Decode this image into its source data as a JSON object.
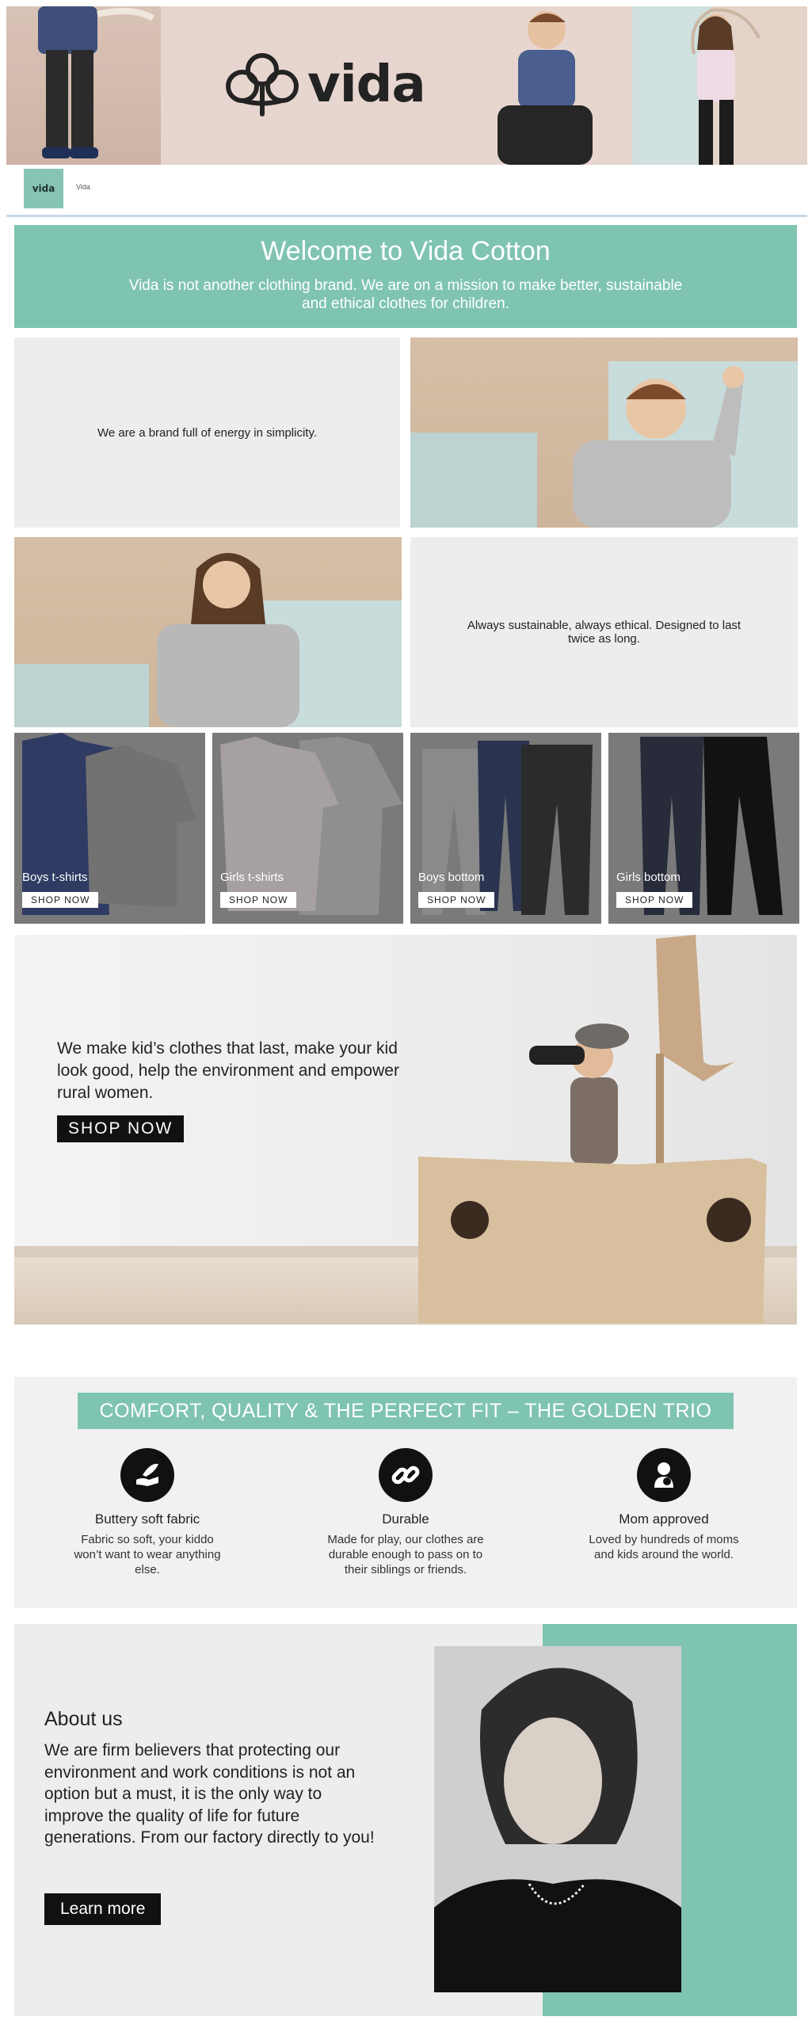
{
  "brand": {
    "logo_word": "vida",
    "nav_name": "Vida"
  },
  "welcome": {
    "title": "Welcome to Vida Cotton",
    "subtitle": "Vida is not another clothing brand. We are on a mission to make better, sustainable and ethical clothes for children."
  },
  "intro": {
    "text1": "We are a brand full of energy in simplicity.",
    "text2": "Always sustainable, always ethical. Designed to last twice as long."
  },
  "products": [
    {
      "label": "Boys t-shirts",
      "button": "SHOP NOW"
    },
    {
      "label": "Girls t-shirts",
      "button": "SHOP NOW"
    },
    {
      "label": "Boys bottom",
      "button": "SHOP NOW"
    },
    {
      "label": "Girls bottom",
      "button": "SHOP NOW"
    }
  ],
  "cta": {
    "text": "We make kid’s clothes that last, make your kid look good, help the environment and empower rural women.",
    "button": "SHOP NOW"
  },
  "trio": {
    "heading": "COMFORT, QUALITY & THE PERFECT FIT – THE GOLDEN TRIO",
    "features": [
      {
        "icon": "hand-feather-icon",
        "title": "Buttery soft fabric",
        "text": "Fabric so soft, your kiddo won’t want to wear anything else."
      },
      {
        "icon": "chain-link-icon",
        "title": "Durable",
        "text": "Made for play, our clothes are durable enough to pass on to their siblings or friends."
      },
      {
        "icon": "mother-child-icon",
        "title": "Mom approved",
        "text": "Loved by hundreds of moms and kids around the world."
      }
    ]
  },
  "about": {
    "title": "About us",
    "text": "We are firm believers that protecting our environment and work conditions is not an option but a must, it is the only way to improve the quality of life for future generations. From our factory directly to you!",
    "button": "Learn more"
  },
  "colors": {
    "accent": "#7fc4b1",
    "dark": "#111111",
    "light_grey": "#ededed"
  }
}
